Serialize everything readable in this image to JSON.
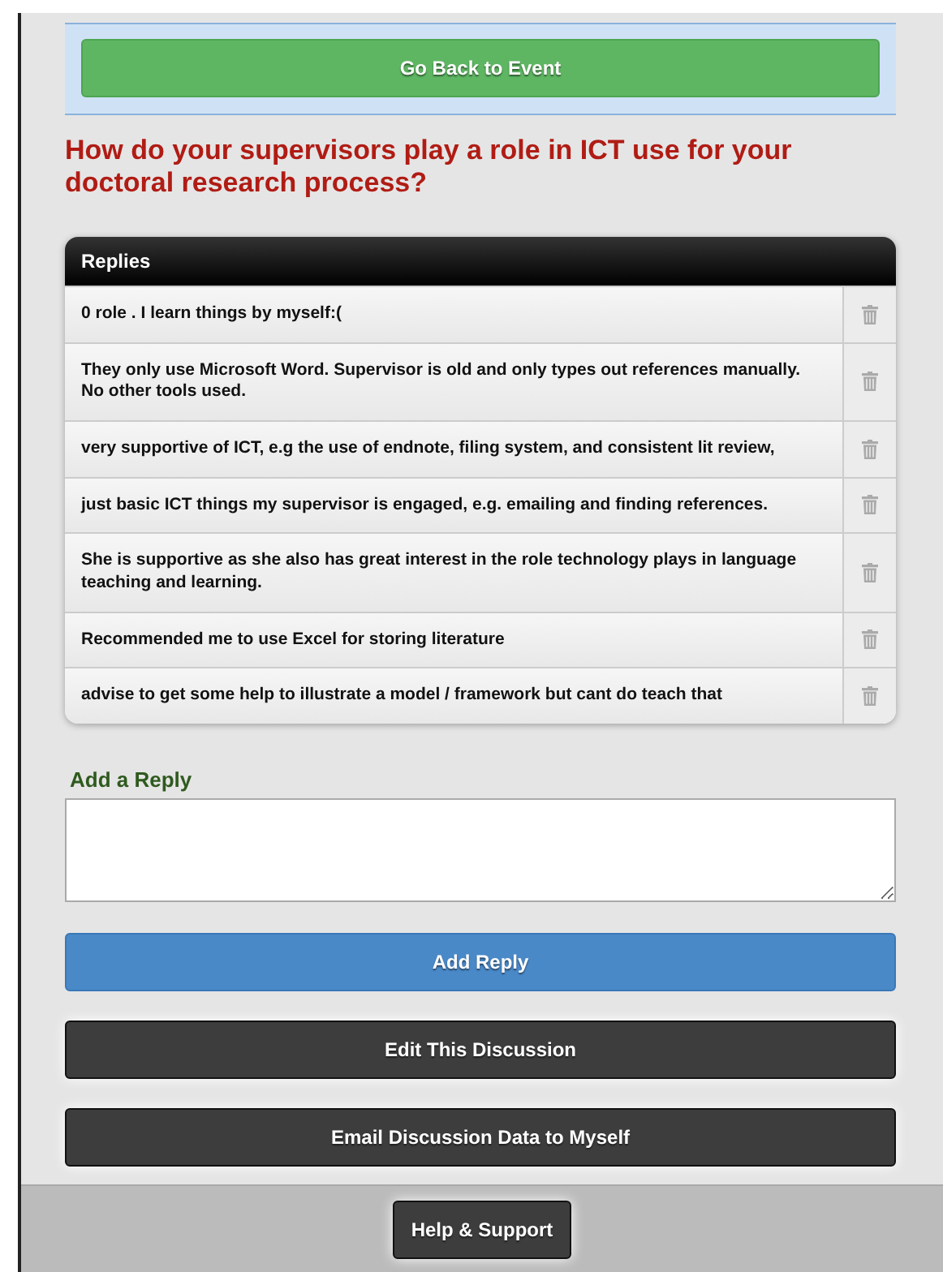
{
  "back_button": "Go Back to Event",
  "question": "How do your supervisors play a role in ICT use for your doctoral research process?",
  "replies": {
    "title": "Replies",
    "rows": [
      {
        "text": "0 role . I learn things by myself:("
      },
      {
        "text": "They only use Microsoft Word. Supervisor is old and only types out references manually. No other tools used."
      },
      {
        "text": "very supportive of ICT, e.g the use of endnote, filing system, and consistent lit review,"
      },
      {
        "text": "just basic ICT things my supervisor is engaged, e.g. emailing and finding references."
      },
      {
        "text": "She is supportive as she also has great interest in the role technology plays in language teaching and learning."
      },
      {
        "text": "Recommended me to use Excel for storing literature"
      },
      {
        "text": "advise to get some help to illustrate a model / framework but cant do teach that"
      }
    ]
  },
  "add_reply": {
    "label": "Add a Reply"
  },
  "actions": [
    {
      "label": "Add Reply",
      "kind": "primary"
    },
    {
      "label": "Edit This Discussion",
      "kind": "dark"
    },
    {
      "label": "Email Discussion Data to Myself",
      "kind": "dark"
    }
  ],
  "footer": {
    "button": "Help & Support"
  }
}
